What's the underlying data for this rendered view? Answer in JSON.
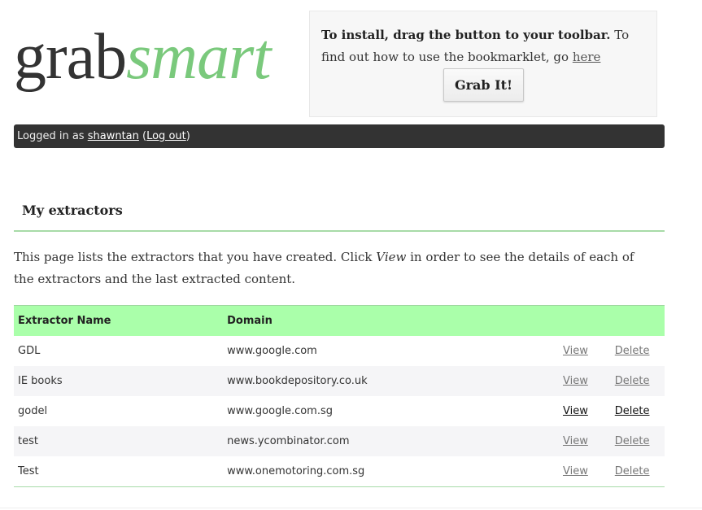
{
  "logo": {
    "part1": "grab",
    "part2": "smart"
  },
  "install": {
    "bold_text": "To install, drag the button to your toolbar.",
    "text": " To find out how to use the bookmarklet, go ",
    "link": "here",
    "button_label": "Grab It!"
  },
  "login": {
    "prefix": "Logged in as ",
    "username": "shawntan",
    "open_paren": " (",
    "logout": "Log out",
    "close_paren": ")"
  },
  "section": {
    "title": "My extractors",
    "intro_before": "This page lists the extractors that you have created. Click ",
    "intro_em": "View",
    "intro_after": " in order to see the details of each of the extractors and the last extracted content."
  },
  "table": {
    "headers": [
      "Extractor Name",
      "Domain",
      "",
      ""
    ],
    "view_label": "View",
    "delete_label": "Delete",
    "rows": [
      {
        "name": "GDL",
        "domain": "www.google.com"
      },
      {
        "name": "IE books",
        "domain": "www.bookdepository.co.uk"
      },
      {
        "name": "godel",
        "domain": "www.google.com.sg"
      },
      {
        "name": "test",
        "domain": "news.ycombinator.com"
      },
      {
        "name": "Test",
        "domain": "www.onemotoring.com.sg"
      }
    ]
  },
  "colors": {
    "accent_green": "#7ac97c",
    "header_green": "#aaffaa",
    "bar_dark": "#333333"
  }
}
